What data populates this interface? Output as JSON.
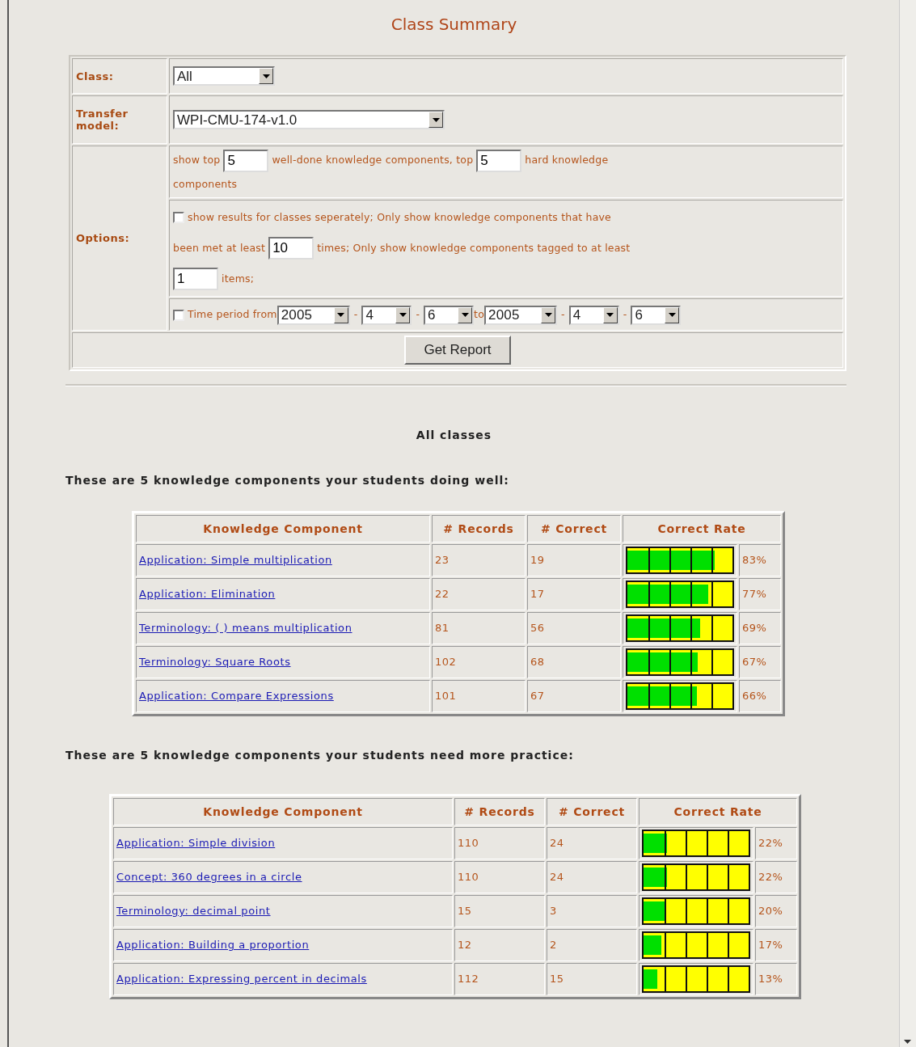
{
  "title": "Class Summary",
  "form": {
    "class": {
      "label": "Class:",
      "value": "All"
    },
    "transfer_model": {
      "label": "Transfer model:",
      "value": "WPI-CMU-174-v1.0"
    },
    "options": {
      "label": "Options:",
      "top_text_1": "show top",
      "top_well": "5",
      "top_text_2": "well-done knowledge components, top",
      "top_hard": "5",
      "top_text_3": "hard knowledge",
      "top_text_4": "components",
      "separate": {
        "checked": false,
        "label": "show results for classes seperately; Only show knowledge components that have",
        "label_2": "been met at least"
      },
      "min_met": "10",
      "text_times": "times; Only show knowledge components tagged to at least",
      "min_items": "1",
      "text_items": "items;",
      "time_period": {
        "checked": false,
        "label": "Time period from",
        "from": [
          "2005",
          "4",
          "6"
        ],
        "to_label": "to",
        "to": [
          "2005",
          "4",
          "6"
        ],
        "from_separators": [
          "-",
          "-"
        ],
        "to_separators": [
          "-",
          "-"
        ]
      }
    },
    "button": "Get Report"
  },
  "heading": "All classes",
  "sections": [
    {
      "caption": "These are 5 knowledge components your students doing well:",
      "columns": [
        "Knowledge Component",
        "# Records",
        "# Correct",
        "Correct Rate"
      ],
      "rows": [
        {
          "component": "Application: Simple multiplication",
          "records": "23",
          "correct": "19",
          "level": 0.83,
          "rate": "83%"
        },
        {
          "component": "Application: Elimination",
          "records": "22",
          "correct": "17",
          "level": 0.77,
          "rate": "77%"
        },
        {
          "component": "Terminology: ( ) means multiplication",
          "records": "81",
          "correct": "56",
          "level": 0.69,
          "rate": "69%"
        },
        {
          "component": "Terminology: Square Roots",
          "records": "102",
          "correct": "68",
          "level": 0.67,
          "rate": "67%"
        },
        {
          "component": "Application: Compare Expressions",
          "records": "101",
          "correct": "67",
          "level": 0.66,
          "rate": "66%"
        }
      ]
    },
    {
      "caption": "These are 5 knowledge components your students need more practice:",
      "columns": [
        "Knowledge Component",
        "# Records",
        "# Correct",
        "Correct Rate"
      ],
      "rows": [
        {
          "component": "Application: Simple division",
          "records": "110",
          "correct": "24",
          "level": 0.22,
          "rate": "22%"
        },
        {
          "component": "Concept: 360 degrees in a circle",
          "records": "110",
          "correct": "24",
          "level": 0.22,
          "rate": "22%"
        },
        {
          "component": "Terminology: decimal point",
          "records": "15",
          "correct": "3",
          "level": 0.2,
          "rate": "20%"
        },
        {
          "component": "Application: Building a proportion",
          "records": "12",
          "correct": "2",
          "level": 0.17,
          "rate": "17%"
        },
        {
          "component": "Application: Expressing percent in decimals",
          "records": "112",
          "correct": "15",
          "level": 0.13,
          "rate": "13%"
        }
      ]
    }
  ]
}
